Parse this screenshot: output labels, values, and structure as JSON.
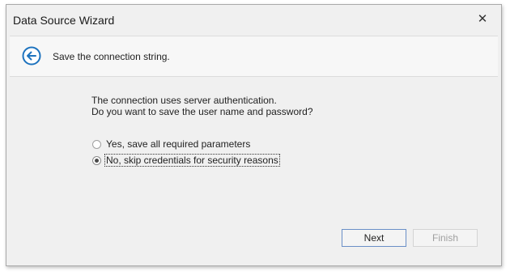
{
  "window": {
    "title": "Data Source Wizard",
    "close_glyph": "✕"
  },
  "header": {
    "back_icon": "arrow-left-circle-icon",
    "text": "Save the connection string.",
    "accent_color": "#1e73be"
  },
  "content": {
    "description_line1": "The connection uses server authentication.",
    "description_line2": "Do you want to save the user name and password?",
    "options": [
      {
        "label": "Yes, save all required parameters",
        "selected": false
      },
      {
        "label": "No, skip credentials for security reasons",
        "selected": true
      }
    ]
  },
  "buttons": {
    "next_label": "Next",
    "finish_label": "Finish",
    "finish_enabled": false
  }
}
